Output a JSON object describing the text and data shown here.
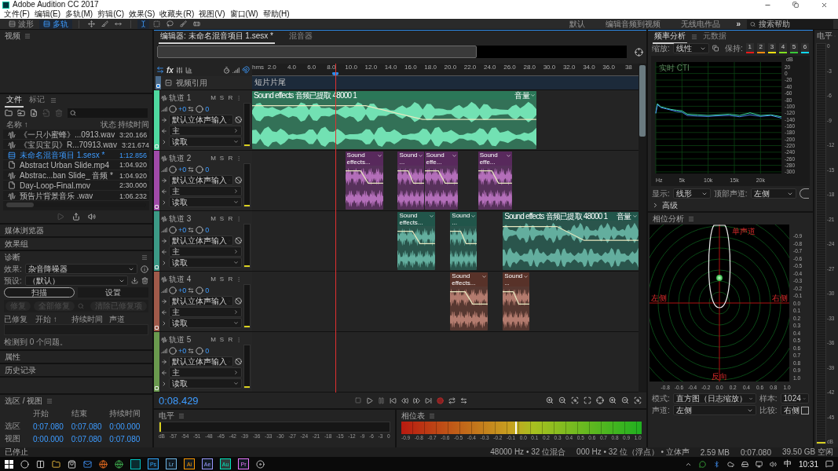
{
  "window": {
    "title": "Adobe Audition CC 2017"
  },
  "menu": [
    "文件(F)",
    "编辑(E)",
    "多轨(M)",
    "剪辑(C)",
    "效果(S)",
    "收藏夹(R)",
    "视图(V)",
    "窗口(W)",
    "帮助(H)"
  ],
  "toolbar": {
    "views": [
      {
        "label": "波形",
        "selected": false
      },
      {
        "label": "多轨",
        "selected": true
      }
    ],
    "tools": [
      {
        "kind": "move",
        "selected": false
      },
      {
        "kind": "razor",
        "selected": false
      },
      {
        "kind": "slip",
        "selected": false
      },
      {
        "kind": "time",
        "selected": true
      },
      {
        "kind": "marquee",
        "selected": false
      },
      {
        "kind": "lasso",
        "selected": false
      },
      {
        "kind": "brush",
        "selected": false
      },
      {
        "kind": "heal",
        "selected": false
      }
    ],
    "workspaces": [
      "默认",
      "编辑音频到视频",
      "无线电作品"
    ],
    "more": "»",
    "search": {
      "placeholder": "搜索帮助"
    }
  },
  "video_panel": {
    "title": "视频"
  },
  "files_panel": {
    "tabs": [
      {
        "label": "文件",
        "selected": true
      },
      {
        "label": "标记",
        "selected": false
      }
    ],
    "columns": [
      "名称 ↑",
      "状态",
      "持续时间"
    ],
    "rows": [
      {
        "kind": "audio",
        "name": "《一只小蜜蜂》...0913.wav",
        "duration": "3:20.166",
        "selected": false
      },
      {
        "kind": "audio",
        "name": "《宝贝宝贝》R...70913.wav",
        "duration": "3:21.674",
        "selected": false
      },
      {
        "kind": "session",
        "name": "未命名混音项目 1.sesx *",
        "duration": "1:12.856",
        "selected": true
      },
      {
        "kind": "video",
        "name": "Abstract Urban Slide.mp4",
        "duration": "1:04.920",
        "selected": false
      },
      {
        "kind": "audio",
        "name": "Abstrac...ban Slide_ 音频 *",
        "duration": "1:04.920",
        "selected": false
      },
      {
        "kind": "video",
        "name": "Day-Loop-Final.mov",
        "duration": "2:30.000",
        "selected": false
      },
      {
        "kind": "audio",
        "name": "预告片背景音乐 .wav",
        "duration": "1:06.232",
        "selected": false
      }
    ]
  },
  "collapsed_panels": [
    {
      "title": "媒体浏览器"
    },
    {
      "title": "效果组"
    }
  ],
  "diagnostics": {
    "title": "诊断",
    "effect_label": "效果:",
    "effect": "杂音降噪器",
    "preset_label": "预设:",
    "preset": "（默认）",
    "buttons": [
      {
        "label": "扫描",
        "selected": true
      },
      {
        "label": "设置",
        "selected": false
      }
    ],
    "actions": [
      {
        "label": "修复",
        "disabled": true
      },
      {
        "label": "全部修复",
        "disabled": true
      },
      {
        "label": "清除已修复项",
        "disabled": true
      }
    ],
    "columns": [
      "已修复",
      "开始 ↑",
      "持续时间",
      "声道"
    ],
    "message": "检测到 0 个问题。"
  },
  "lower_panels": [
    {
      "title": "属性"
    },
    {
      "title": "历史记录"
    }
  ],
  "selection_view": {
    "title": "选区 / 视图",
    "columns": [
      "开始",
      "结束",
      "持续时间"
    ],
    "rows": [
      {
        "label": "选区",
        "values": [
          "0:07.080",
          "0:07.080",
          "0:00.000"
        ]
      },
      {
        "label": "视图",
        "values": [
          "0:00.000",
          "0:07.080",
          "0:07.080"
        ]
      }
    ]
  },
  "editor": {
    "tabs": [
      {
        "label": "编辑器: 未命名混音项目 1.sesx *",
        "selected": true
      },
      {
        "label": "混音器",
        "selected": false
      }
    ],
    "fx": "fx",
    "ruler": [
      "hms",
      "2.0",
      "4.0",
      "6.0",
      "8.0",
      "10.0",
      "12.0",
      "14.0",
      "16.0",
      "18.0",
      "20.0",
      "22.0",
      "24.0",
      "26.0",
      "28.0",
      "30.0",
      "32.0",
      "34.0",
      "36.0",
      "38"
    ],
    "video_track": {
      "name": "视频引用",
      "clip": "短片片尾"
    },
    "tracks": [
      {
        "name": "轨道 1",
        "color": "#4fd9a0",
        "buttons": [
          "M",
          "S",
          "R"
        ],
        "volume": "+0",
        "pan": "0",
        "input": "默认立体声输入",
        "output": "主",
        "automation": "读取",
        "clips": [
          {
            "title": "Sound effects 音频已提取 48000 1",
            "badge": "音量"
          }
        ]
      },
      {
        "name": "轨道 2",
        "color": "#a04aa8",
        "buttons": [
          "M",
          "S",
          "R"
        ],
        "volume": "+0",
        "pan": "0",
        "input": "默认立体声输入",
        "output": "主",
        "automation": "读取",
        "clips": [
          {
            "title": "Sound effects..."
          },
          {
            "title": "Sound ..."
          },
          {
            "title": "Sound effe..."
          },
          {
            "title": "Sound effe..."
          }
        ]
      },
      {
        "name": "轨道 3",
        "color": "#3c9a86",
        "buttons": [
          "M",
          "S",
          "R"
        ],
        "volume": "+0",
        "pan": "0",
        "input": "默认立体声输入",
        "output": "主",
        "automation": "读取",
        "clips": [
          {
            "title": "Sound effects..."
          },
          {
            "title": "Sound ..."
          },
          {
            "title": "Sound effects 音频已提取 48000 1",
            "badge": "音量"
          }
        ]
      },
      {
        "name": "轨道 4",
        "color": "#a05a4a",
        "buttons": [
          "M",
          "S",
          "R"
        ],
        "volume": "+0",
        "pan": "0",
        "input": "默认立体声输入",
        "output": "主",
        "automation": "读取",
        "clips": [
          {
            "title": "Sound effects..."
          },
          {
            "title": "Sound ..."
          }
        ]
      },
      {
        "name": "轨道 5",
        "color": "#6a9a4e",
        "buttons": [
          "M",
          "S",
          "R"
        ],
        "volume": "+0",
        "pan": "0",
        "input": "默认立体声输入",
        "output": "主",
        "automation": "读取"
      }
    ],
    "time": "0:08.429"
  },
  "level_panel": {
    "title": "电平",
    "scale": [
      "dB",
      "-57",
      "-54",
      "-51",
      "-48",
      "-45",
      "-42",
      "-39",
      "-36",
      "-33",
      "-30",
      "-27",
      "-24",
      "-21",
      "-18",
      "-15",
      "-12",
      "-9",
      "-6",
      "-3",
      "0"
    ]
  },
  "phase_meter": {
    "title": "相位表",
    "scale": [
      "-0.9",
      "-0.8",
      "-0.7",
      "-0.6",
      "-0.5",
      "-0.4",
      "-0.3",
      "-0.2",
      "-0.1",
      "0.0",
      "0.1",
      "0.2",
      "0.3",
      "0.4",
      "0.5",
      "0.6",
      "0.7",
      "0.8",
      "0.9",
      "1.0"
    ]
  },
  "frequency": {
    "tabs": [
      {
        "label": "频率分析",
        "selected": true
      },
      {
        "label": "元数据",
        "selected": false
      }
    ],
    "zoom_label": "缩放:",
    "zoom": "线性",
    "hold_label": "保持:",
    "hold": [
      {
        "label": "1",
        "color": "#e81818"
      },
      {
        "label": "2",
        "color": "#f08a10"
      },
      {
        "label": "3",
        "color": "#f0e010"
      },
      {
        "label": "4",
        "color": "#80e020"
      },
      {
        "label": "5",
        "color": "#38c838"
      },
      {
        "label": "6",
        "color": "#10d8f0"
      }
    ],
    "chart_data": {
      "type": "line",
      "grid": true,
      "title": "实时 CTI",
      "ylabel": "dB",
      "xlim": [
        0,
        24000
      ],
      "ylim": [
        -305,
        35
      ],
      "xticks": [
        {
          "value": 0,
          "label": "Hz"
        },
        {
          "value": 5000,
          "label": "5k"
        },
        {
          "value": 10000,
          "label": "10k"
        },
        {
          "value": 15000,
          "label": "15k"
        },
        {
          "value": 20000,
          "label": "20k"
        }
      ],
      "yticks": [
        20,
        0,
        -20,
        -40,
        -60,
        -80,
        -100,
        -120,
        -140,
        -160,
        -180,
        -200,
        -220,
        -240,
        -260,
        -280,
        -300
      ],
      "x": [
        0,
        300,
        1000,
        2000,
        3000,
        4000,
        5000,
        6000,
        8000,
        10000,
        12000,
        14000,
        16000,
        18000,
        20000,
        22000,
        24000
      ],
      "series": [
        {
          "color": "#3fe0a8",
          "values": [
            -120,
            -92,
            -102,
            -106,
            -110,
            -112,
            -114,
            -124,
            -126,
            -128,
            -126,
            -124,
            -128,
            -120,
            -128,
            -126,
            -132
          ]
        },
        {
          "color": "#4a8af0",
          "values": [
            -122,
            -95,
            -104,
            -108,
            -112,
            -116,
            -118,
            -128,
            -130,
            -131,
            -129,
            -128,
            -132,
            -126,
            -131,
            -128,
            -136
          ]
        }
      ]
    },
    "display_label": "显示:",
    "display": "线形",
    "top_channel_label": "顶部声道:",
    "top_channel": "左侧",
    "advanced": {
      "label": "高级",
      "expanded": false
    }
  },
  "phase_analysis": {
    "title": "相位分析",
    "labels": {
      "top": "单声道",
      "left": "左侧",
      "right": "右侧",
      "bottom": "反向"
    },
    "y_scale": [
      "-0.9",
      "-0.8",
      "-0.7",
      "-0.6",
      "-0.5",
      "-0.4",
      "-0.3",
      "-0.2",
      "-0.1",
      "0.0",
      "0.1",
      "0.2",
      "0.3",
      "0.4",
      "0.5",
      "0.6",
      "0.7",
      "0.8",
      "0.9",
      "1.0"
    ],
    "x_scale": [
      "-0.8",
      "-0.6",
      "-0.4",
      "-0.2",
      "0.0",
      "0.2",
      "0.4",
      "0.6",
      "0.8",
      "1.0"
    ],
    "mode_label": "模式:",
    "mode": "直方图（日志缩放）",
    "samples_label": "样本:",
    "samples": "1024",
    "channel_label": "声道:",
    "channel": "左侧",
    "compare_label": "比较:",
    "compare": "右侧",
    "compare_checked": false
  },
  "level_meter": {
    "title": "电平",
    "scale": [
      "0",
      "-3",
      "-6",
      "-9",
      "-12",
      "-15",
      "-18",
      "-21",
      "-24",
      "-27",
      "-30",
      "-33",
      "-36",
      "-39",
      "-42",
      "-45",
      "dB"
    ]
  },
  "status": {
    "state": "已停止",
    "items": [
      "48000 Hz • 32 位混合",
      "000 Hz • 32 位（浮点） • 立体声",
      "2.59 MB",
      "0:07.080",
      "39.50 GB 空闲"
    ]
  },
  "taskbar": {
    "apps": [
      {
        "label": "Ps",
        "color": "#31a8ff",
        "selected": false
      },
      {
        "label": "Lr",
        "color": "#6fb8e8",
        "selected": false
      },
      {
        "label": "Ai",
        "color": "#ff9a00",
        "selected": false
      },
      {
        "label": "Ae",
        "color": "#9999ff",
        "selected": false
      },
      {
        "label": "Au",
        "color": "#00e4bb",
        "selected": true
      },
      {
        "label": "Pr",
        "color": "#ea77ff",
        "selected": false
      }
    ],
    "ime": "中",
    "clock": "10:31"
  }
}
